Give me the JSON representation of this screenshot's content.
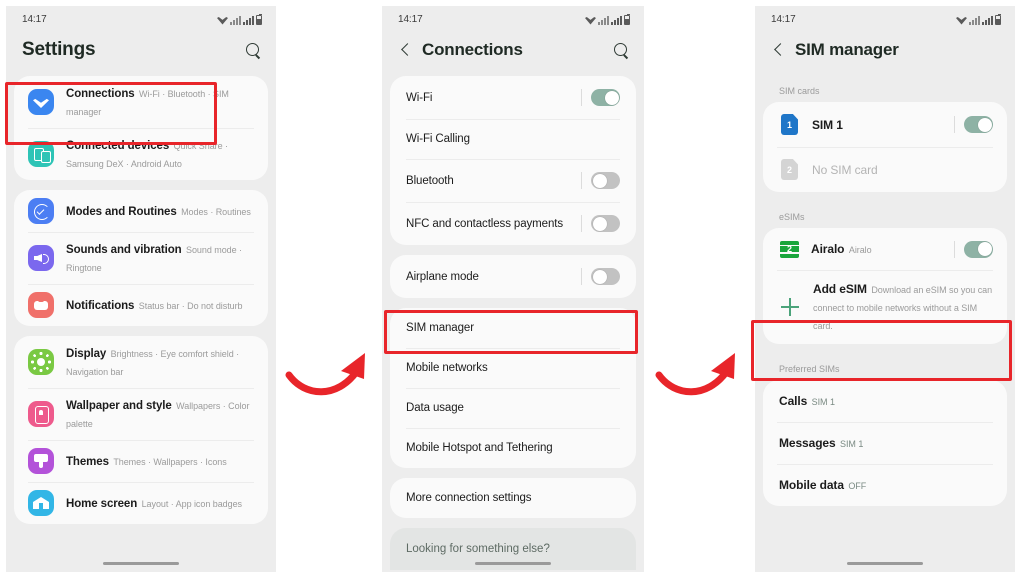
{
  "status_bar": {
    "time": "14:17",
    "icons": [
      "wifi-icon",
      "signal-icon",
      "signal-icon-2",
      "battery-icon"
    ]
  },
  "screen1": {
    "title": "Settings",
    "search_icon": "search-icon",
    "groups": [
      {
        "items": [
          {
            "icon": "wifi-icon",
            "title": "Connections",
            "sub": "Wi-Fi  ·  Bluetooth  ·  SIM manager",
            "highlighted": true
          },
          {
            "icon": "connected-devices-icon",
            "title": "Connected devices",
            "sub": "Quick Share  ·  Samsung DeX  ·  Android Auto"
          }
        ]
      },
      {
        "items": [
          {
            "icon": "modes-routines-icon",
            "title": "Modes and Routines",
            "sub": "Modes  ·  Routines"
          },
          {
            "icon": "sound-icon",
            "title": "Sounds and vibration",
            "sub": "Sound mode  ·  Ringtone"
          },
          {
            "icon": "notifications-icon",
            "title": "Notifications",
            "sub": "Status bar  ·  Do not disturb"
          }
        ]
      },
      {
        "items": [
          {
            "icon": "display-icon",
            "title": "Display",
            "sub": "Brightness  ·  Eye comfort shield  ·  Navigation bar"
          },
          {
            "icon": "wallpaper-icon",
            "title": "Wallpaper and style",
            "sub": "Wallpapers  ·  Color palette"
          },
          {
            "icon": "themes-icon",
            "title": "Themes",
            "sub": "Themes  ·  Wallpapers  ·  Icons"
          },
          {
            "icon": "home-screen-icon",
            "title": "Home screen",
            "sub": "Layout  ·  App icon badges"
          }
        ]
      }
    ]
  },
  "screen2": {
    "title": "Connections",
    "back_icon": "back-arrow-icon",
    "search_icon": "search-icon",
    "groups": [
      {
        "items": [
          {
            "label": "Wi-Fi",
            "toggle": "on"
          },
          {
            "label": "Wi-Fi Calling",
            "toggle": null
          },
          {
            "label": "Bluetooth",
            "toggle": "off"
          },
          {
            "label": "NFC and contactless payments",
            "toggle": "off"
          }
        ]
      },
      {
        "items": [
          {
            "label": "Airplane mode",
            "toggle": "off"
          }
        ]
      },
      {
        "items": [
          {
            "label": "SIM manager",
            "toggle": null,
            "highlighted": true
          },
          {
            "label": "Mobile networks",
            "toggle": null
          },
          {
            "label": "Data usage",
            "toggle": null
          },
          {
            "label": "Mobile Hotspot and Tethering",
            "toggle": null
          }
        ]
      },
      {
        "items": [
          {
            "label": "More connection settings",
            "toggle": null
          }
        ]
      }
    ],
    "footer": "Looking for something else?"
  },
  "screen3": {
    "title": "SIM manager",
    "back_icon": "back-arrow-icon",
    "sections": [
      {
        "label": "SIM cards",
        "items": [
          {
            "badge": "1",
            "badge_style": "blue",
            "title": "SIM 1",
            "sub": null,
            "toggle": "on"
          },
          {
            "badge": "2",
            "badge_style": "grey",
            "title": "No SIM card",
            "sub": null,
            "toggle": null,
            "disabled": true
          }
        ]
      },
      {
        "label": "eSIMs",
        "items": [
          {
            "badge": "2",
            "badge_style": "esim",
            "title": "Airalo",
            "sub": "Airalo",
            "toggle": "on"
          },
          {
            "badge": "+",
            "badge_style": "plus",
            "title": "Add eSIM",
            "sub": "Download an eSIM so you can connect to mobile networks without a SIM card.",
            "toggle": null,
            "highlighted": true
          }
        ]
      },
      {
        "label": "Preferred SIMs",
        "items": [
          {
            "title": "Calls",
            "sub": "SIM 1"
          },
          {
            "title": "Messages",
            "sub": "SIM 1"
          },
          {
            "title": "Mobile data",
            "sub": "OFF"
          }
        ]
      }
    ]
  },
  "annotations": {
    "highlight_color": "#e8252a",
    "arrow_color": "#e8252a",
    "arrows": [
      {
        "name": "arrow-settings-to-connections",
        "from": "screen1",
        "to": "screen2"
      },
      {
        "name": "arrow-connections-to-simmanager",
        "from": "screen2",
        "to": "screen3"
      }
    ],
    "highlights": [
      {
        "name": "highlight-connections-row",
        "target": "Connections"
      },
      {
        "name": "highlight-sim-manager-row",
        "target": "SIM manager"
      },
      {
        "name": "highlight-add-esim-row",
        "target": "Add eSIM"
      }
    ]
  }
}
